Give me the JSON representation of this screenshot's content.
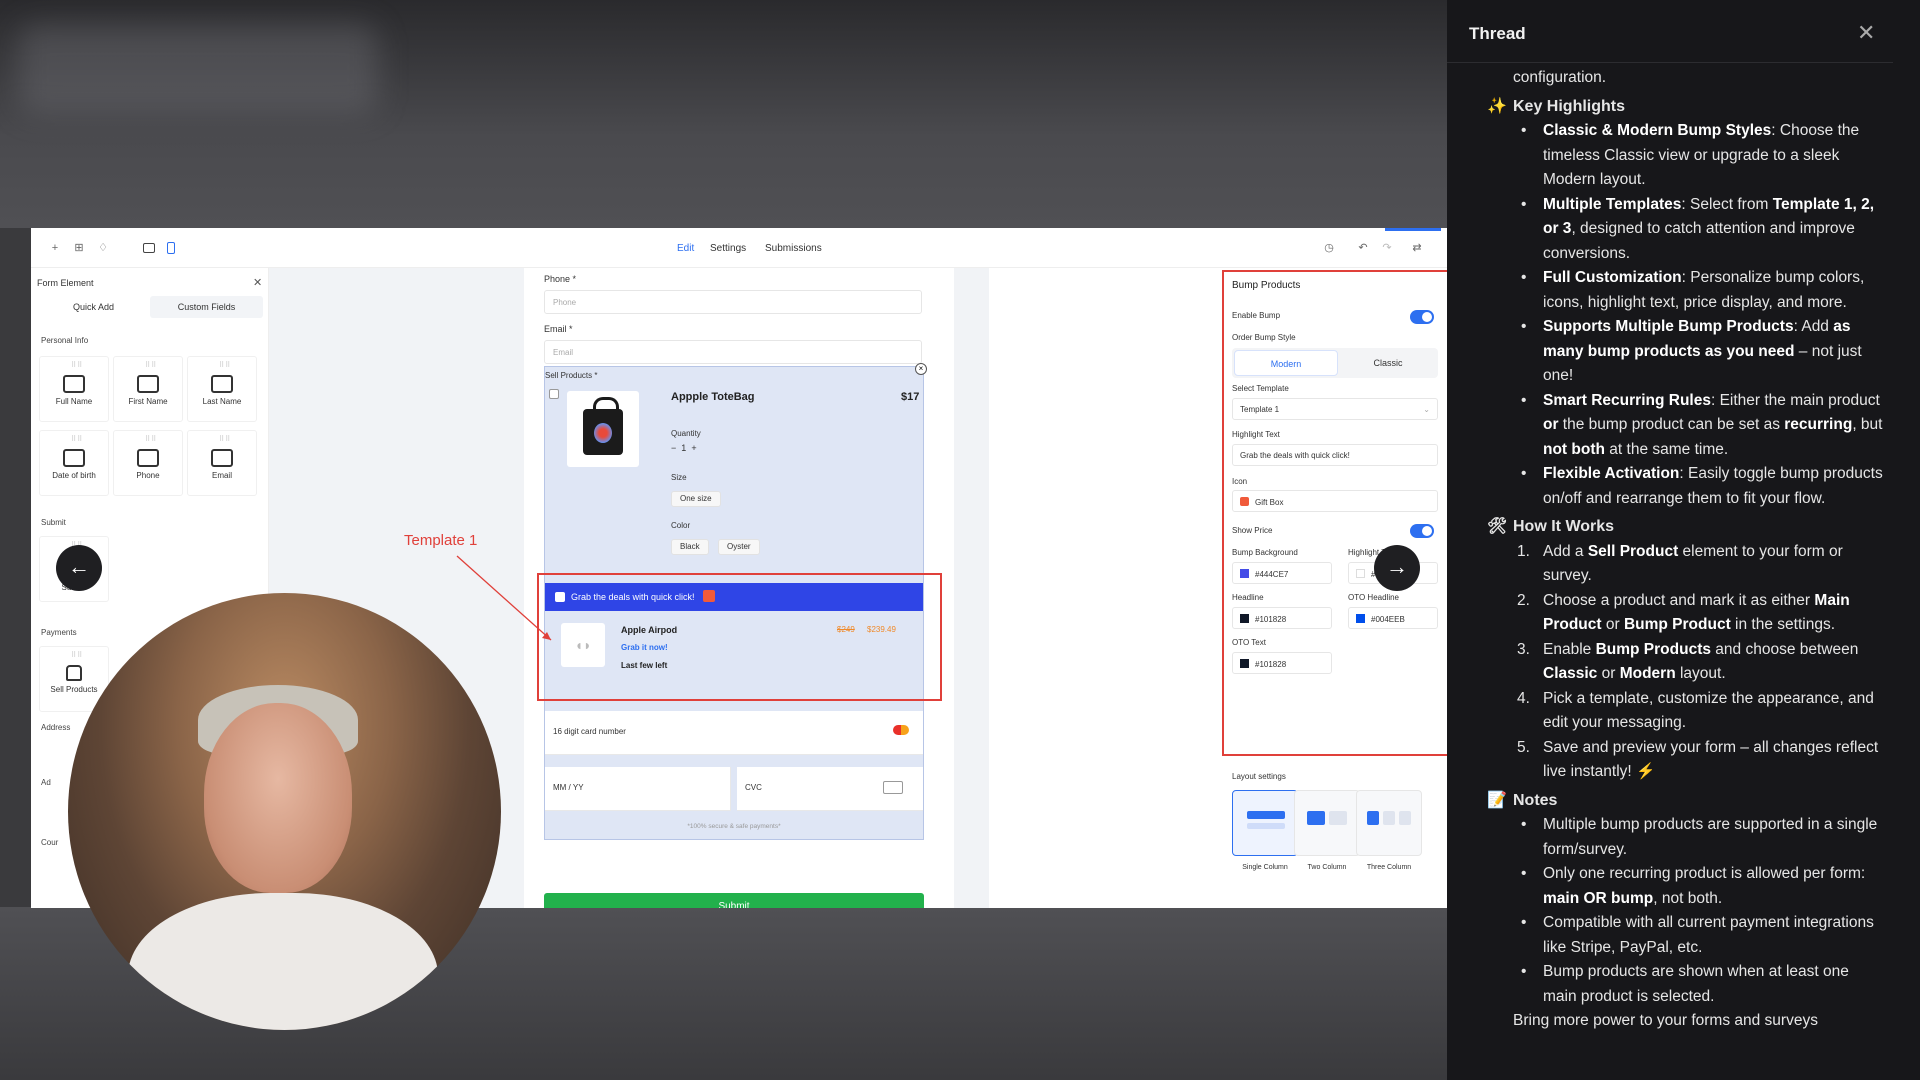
{
  "editor": {
    "top_tabs": [
      "Edit",
      "Settings",
      "Submissions"
    ],
    "left_panel": {
      "title": "Form Element",
      "tabs": [
        "Quick Add",
        "Custom Fields"
      ],
      "section_personal": "Personal Info",
      "personal_items": [
        "Full Name",
        "First Name",
        "Last Name",
        "Date of birth",
        "Phone",
        "Email"
      ],
      "section_submit": "Submit",
      "submit_item": "Submit",
      "section_payments": "Payments",
      "payments_item": "Sell Products",
      "section_address": "Address",
      "address_items": [
        "Ad",
        "Cour"
      ]
    },
    "form": {
      "phone_label": "Phone *",
      "phone_placeholder": "Phone",
      "email_label": "Email *",
      "email_placeholder": "Email",
      "sell_label": "Sell Products *",
      "product_name": "Appple ToteBag",
      "product_price": "$17",
      "quantity_label": "Quantity",
      "quantity_value": "1",
      "size_label": "Size",
      "size_value": "One size",
      "color_label": "Color",
      "color_options": [
        "Black",
        "Oyster"
      ],
      "bump_header": "Grab the deals with quick click!",
      "bump_product": "Apple Airpod",
      "bump_cta": "Grab it now!",
      "bump_note": "Last few left",
      "bump_old_price": "$249",
      "bump_new_price": "$239.49",
      "card_number": "16 digit card number",
      "mmyy": "MM / YY",
      "cvc": "CVC",
      "secure_note": "*100% secure & safe payments*",
      "submit": "Submit"
    },
    "annotation": "Template 1",
    "right_panel": {
      "title": "Bump Products",
      "enable_bump": "Enable Bump",
      "order_bump_style": "Order Bump Style",
      "style_options": [
        "Modern",
        "Classic"
      ],
      "select_template": "Select Template",
      "template_value": "Template 1",
      "highlight_text_label": "Highlight Text",
      "highlight_text_value": "Grab the deals with quick click!",
      "icon_label": "Icon",
      "icon_value": "Gift Box",
      "show_price": "Show Price",
      "bump_background": "Bump Background",
      "bump_background_value": "#444CE7",
      "highlight_text_color_label": "Highlight Text",
      "highlight_text_color_value": "#FFFFFF",
      "headline": "Headline",
      "headline_value": "#101828",
      "oto_headline": "OTO Headline",
      "oto_headline_value": "#004EEB",
      "oto_text": "OTO Text",
      "oto_text_value": "#101828",
      "layout_settings": "Layout settings",
      "layouts": [
        "Single Column",
        "Two Column",
        "Three Column"
      ]
    }
  },
  "thread": {
    "title": "Thread",
    "intro": "configuration.",
    "key_highlights_title": "Key Highlights",
    "highlights": [
      {
        "bold": "Classic & Modern Bump Styles",
        "text": ": Choose the timeless Classic view or upgrade to a sleek Modern layout."
      },
      {
        "bold": "Multiple Templates",
        "text": ": Select from ",
        "bold2": "Template 1, 2, or 3",
        "text2": ", designed to catch attention and improve conversions."
      },
      {
        "bold": "Full Customization",
        "text": ": Personalize bump colors, icons, highlight text, price display, and more."
      },
      {
        "bold": "Supports Multiple Bump Products",
        "text": ": Add ",
        "bold2": "as many bump products as you need",
        "text2": " – not just one!"
      },
      {
        "bold": "Smart Recurring Rules",
        "text": ": Either the main product ",
        "bold2": "or",
        "text2": " the bump product can be set as ",
        "bold3": "recurring",
        "text3": ", but ",
        "bold4": "not both",
        "text4": " at the same time."
      },
      {
        "bold": "Flexible Activation",
        "text": ": Easily toggle bump products on/off and rearrange them to fit your flow."
      }
    ],
    "how_title": "How It Works",
    "steps": [
      {
        "n": "1.",
        "t1": "Add a ",
        "b1": "Sell Product",
        "t2": " element to your form or survey."
      },
      {
        "n": "2.",
        "t1": "Choose a product and mark it as either ",
        "b1": "Main Product",
        "t2": " or ",
        "b2": "Bump Product",
        "t3": " in the settings."
      },
      {
        "n": "3.",
        "t1": "Enable ",
        "b1": "Bump Products",
        "t2": " and choose between ",
        "b2": "Classic",
        "t3": " or ",
        "b3": "Modern",
        "t4": " layout."
      },
      {
        "n": "4.",
        "t1": "Pick a template, customize the appearance, and edit your messaging."
      },
      {
        "n": "5.",
        "t1": "Save and preview your form – all changes reflect live instantly! ⚡"
      }
    ],
    "notes_title": "Notes",
    "notes": [
      "Multiple bump products are supported in a single form/survey.",
      "Only one recurring product is allowed per form: main OR bump, not both.",
      "Compatible with all current payment integrations like Stripe, PayPal, etc.",
      "Bump products are shown when at least one main product is selected."
    ],
    "notes_bold": {
      "1": "main OR bump"
    },
    "outro": "Bring more power to your forms and surveys",
    "icons": {
      "highlights": "sparkles-icon",
      "how": "hammer-wrench-icon",
      "notes": "memo-icon"
    }
  },
  "colors": {
    "bump_bar": "#2F45E6",
    "accent_blue": "#2D6FF0",
    "annotation_red": "#E0403A",
    "submit_green": "#22B14C"
  }
}
